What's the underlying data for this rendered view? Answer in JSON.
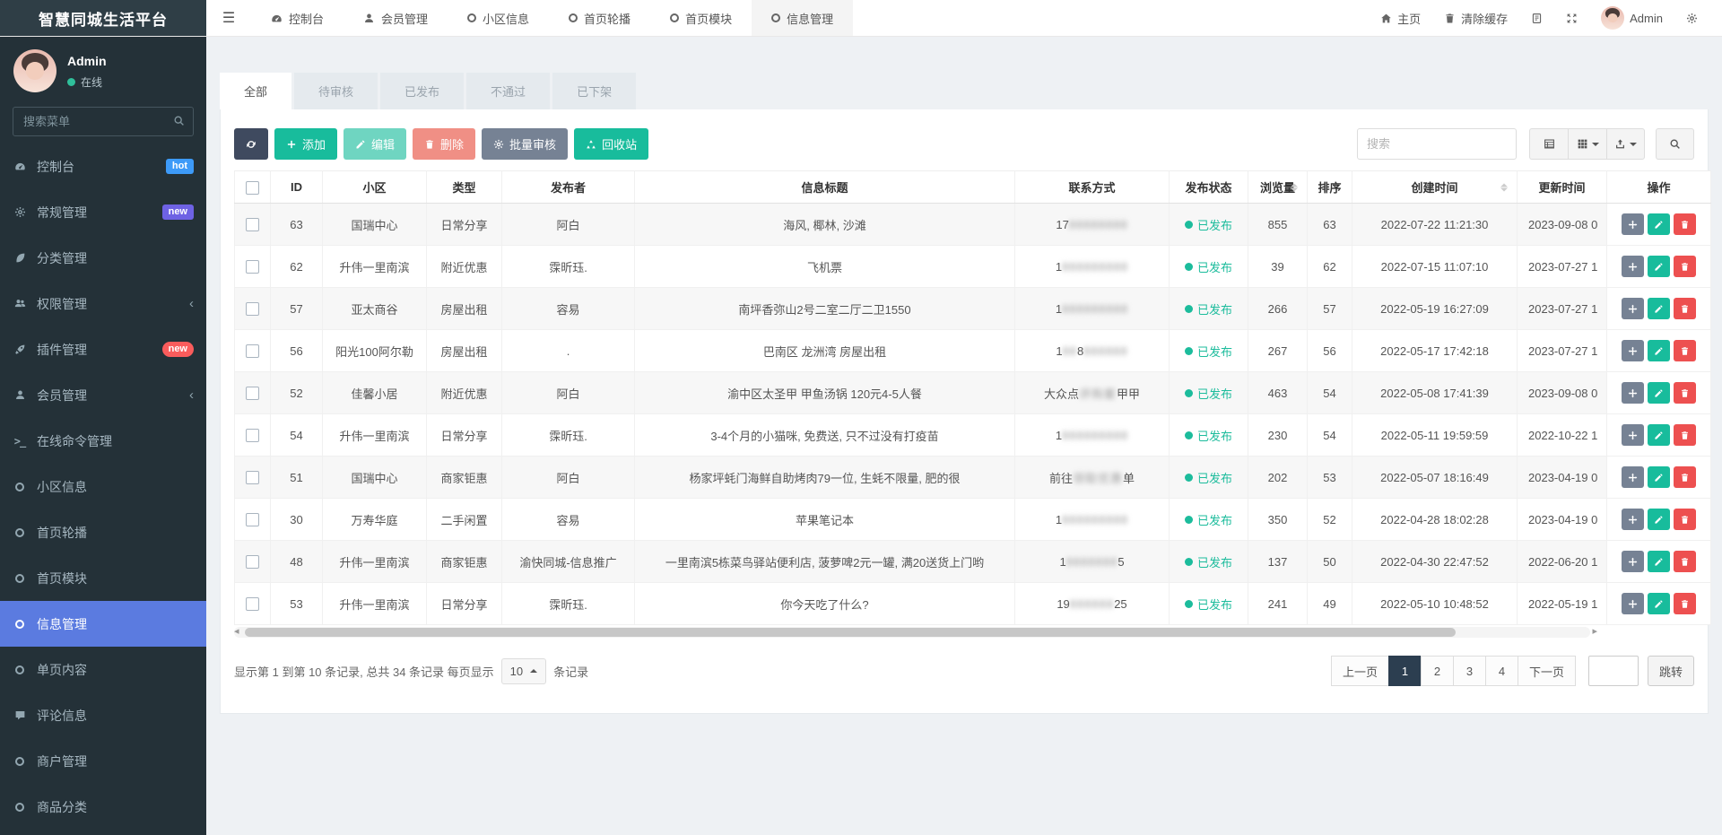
{
  "brand": "智慧同城生活平台",
  "topnav": {
    "tabs": [
      {
        "label": "控制台",
        "icon": "dashboard",
        "active": false
      },
      {
        "label": "会员管理",
        "icon": "user",
        "active": false
      },
      {
        "label": "小区信息",
        "icon": "circle",
        "active": false
      },
      {
        "label": "首页轮播",
        "icon": "circle",
        "active": false
      },
      {
        "label": "首页模块",
        "icon": "circle",
        "active": false
      },
      {
        "label": "信息管理",
        "icon": "circle",
        "active": true
      }
    ],
    "right": {
      "home": "主页",
      "clear_cache": "清除缓存",
      "username": "Admin"
    }
  },
  "sidebar": {
    "user": {
      "name": "Admin",
      "status": "在线"
    },
    "search_placeholder": "搜索菜单",
    "items": [
      {
        "label": "控制台",
        "icon": "dashboard",
        "badge": "hot",
        "badge_color": "#3d9af8",
        "badge_pill": false
      },
      {
        "label": "常规管理",
        "icon": "gear",
        "badge": "new",
        "badge_color": "#6e62e4",
        "badge_pill": false
      },
      {
        "label": "分类管理",
        "icon": "leaf"
      },
      {
        "label": "权限管理",
        "icon": "users",
        "chevron": true
      },
      {
        "label": "插件管理",
        "icon": "rocket",
        "badge": "new",
        "badge_color": "#fa5c5c",
        "badge_pill": true
      },
      {
        "label": "会员管理",
        "icon": "user",
        "chevron": true
      },
      {
        "label": "在线命令管理",
        "icon": "terminal"
      },
      {
        "label": "小区信息",
        "icon": "circle"
      },
      {
        "label": "首页轮播",
        "icon": "circle"
      },
      {
        "label": "首页模块",
        "icon": "circle"
      },
      {
        "label": "信息管理",
        "icon": "circle",
        "active": true
      },
      {
        "label": "单页内容",
        "icon": "circle"
      },
      {
        "label": "评论信息",
        "icon": "comment"
      },
      {
        "label": "商户管理",
        "icon": "circle"
      },
      {
        "label": "商品分类",
        "icon": "circle"
      }
    ]
  },
  "status_tabs": [
    {
      "label": "全部",
      "active": true
    },
    {
      "label": "待审核",
      "active": false
    },
    {
      "label": "已发布",
      "active": false
    },
    {
      "label": "不通过",
      "active": false
    },
    {
      "label": "已下架",
      "active": false
    }
  ],
  "toolbar": {
    "search_placeholder": "搜索",
    "buttons": [
      {
        "name": "refresh",
        "icon": "refresh",
        "label": "",
        "color": "#3f4a5f",
        "disabled": false
      },
      {
        "name": "add",
        "icon": "plus",
        "label": "添加",
        "color": "#18bc9c",
        "disabled": false
      },
      {
        "name": "edit",
        "icon": "pencil",
        "label": "编辑",
        "color": "#18bc9c",
        "disabled": true
      },
      {
        "name": "delete",
        "icon": "trash",
        "label": "删除",
        "color": "#e74c3c",
        "disabled": true
      },
      {
        "name": "batch-audit",
        "icon": "gear",
        "label": "批量审核",
        "color": "#768294",
        "disabled": false
      },
      {
        "name": "recycle-bin",
        "icon": "recycle",
        "label": "回收站",
        "color": "#18bc9c",
        "disabled": false
      }
    ],
    "view_buttons": [
      {
        "name": "view-list",
        "icon": "list",
        "caret": false
      },
      {
        "name": "view-grid",
        "icon": "grid",
        "caret": true
      },
      {
        "name": "export",
        "icon": "export",
        "caret": true
      }
    ]
  },
  "table": {
    "columns": [
      {
        "label": "",
        "checkbox": true
      },
      {
        "label": "ID"
      },
      {
        "label": "小区"
      },
      {
        "label": "类型"
      },
      {
        "label": "发布者"
      },
      {
        "label": "信息标题"
      },
      {
        "label": "联系方式"
      },
      {
        "label": "发布状态"
      },
      {
        "label": "浏览量",
        "sortable": true
      },
      {
        "label": "排序"
      },
      {
        "label": "创建时间",
        "sortable": true
      },
      {
        "label": "更新时间"
      },
      {
        "label": "操作",
        "ops": true
      }
    ],
    "ops_buttons": [
      {
        "name": "move",
        "icon": "move",
        "color": "#768294"
      },
      {
        "name": "edit-row",
        "icon": "pencil",
        "color": "#18bc9c"
      },
      {
        "name": "delete-row",
        "icon": "trash",
        "color": "#ed5050"
      }
    ],
    "status_published": "已发布",
    "rows": [
      {
        "id": "63",
        "community": "国瑞中心",
        "type": "日常分享",
        "publisher": "阿白",
        "title": "海风, 椰林, 沙滩",
        "contact": [
          {
            "t": "17",
            "blur": false
          },
          {
            "t": "88888888",
            "blur": true
          }
        ],
        "views": "855",
        "sort": "63",
        "created": "2022-07-22 11:21:30",
        "updated": "2023-09-08 0"
      },
      {
        "id": "62",
        "community": "升伟一里南滨",
        "type": "附近优惠",
        "publisher": "霂昕珏.",
        "title": "飞机票",
        "contact": [
          {
            "t": "1",
            "blur": false
          },
          {
            "t": "888888888",
            "blur": true
          }
        ],
        "views": "39",
        "sort": "62",
        "created": "2022-07-15 11:07:10",
        "updated": "2023-07-27 1"
      },
      {
        "id": "57",
        "community": "亚太商谷",
        "type": "房屋出租",
        "publisher": "容易",
        "title": "南坪香弥山2号二室二厅二卫1550",
        "contact": [
          {
            "t": "1",
            "blur": false
          },
          {
            "t": "888888888",
            "blur": true
          }
        ],
        "views": "266",
        "sort": "57",
        "created": "2022-05-19 16:27:09",
        "updated": "2023-07-27 1"
      },
      {
        "id": "56",
        "community": "阳光100阿尔勒",
        "type": "房屋出租",
        "publisher": ".",
        "title": "巴南区 龙洲湾 房屋出租",
        "contact": [
          {
            "t": "1",
            "blur": false
          },
          {
            "t": "88",
            "blur": true
          },
          {
            "t": "8",
            "blur": false
          },
          {
            "t": "888888",
            "blur": true
          }
        ],
        "views": "267",
        "sort": "56",
        "created": "2022-05-17 17:42:18",
        "updated": "2023-07-27 1"
      },
      {
        "id": "52",
        "community": "佳馨小居",
        "type": "附近优惠",
        "publisher": "阿白",
        "title": "渝中区太圣甲 甲鱼汤锅 120元4-5人餐",
        "contact": [
          {
            "t": "大众点",
            "blur": false
          },
          {
            "t": "评购套",
            "blur": true
          },
          {
            "t": "甲甲",
            "blur": false
          }
        ],
        "views": "463",
        "sort": "54",
        "created": "2022-05-08 17:41:39",
        "updated": "2023-09-08 0"
      },
      {
        "id": "54",
        "community": "升伟一里南滨",
        "type": "日常分享",
        "publisher": "霂昕珏.",
        "title": "3-4个月的小猫咪, 免费送, 只不过没有打疫苗",
        "contact": [
          {
            "t": "1",
            "blur": false
          },
          {
            "t": "888888888",
            "blur": true
          }
        ],
        "views": "230",
        "sort": "54",
        "created": "2022-05-11 19:59:59",
        "updated": "2022-10-22 1"
      },
      {
        "id": "51",
        "community": "国瑞中心",
        "type": "商家钜惠",
        "publisher": "阿白",
        "title": "杨家坪蚝门海鲜自助烤肉79一位, 生蚝不限量, 肥的很",
        "contact": [
          {
            "t": "前往",
            "blur": false
          },
          {
            "t": "领取优惠",
            "blur": true
          },
          {
            "t": "单",
            "blur": false
          }
        ],
        "views": "202",
        "sort": "53",
        "created": "2022-05-07 18:16:49",
        "updated": "2023-04-19 0"
      },
      {
        "id": "30",
        "community": "万寿华庭",
        "type": "二手闲置",
        "publisher": "容易",
        "title": "苹果笔记本",
        "contact": [
          {
            "t": "1",
            "blur": false
          },
          {
            "t": "888888888",
            "blur": true
          }
        ],
        "views": "350",
        "sort": "52",
        "created": "2022-04-28 18:02:28",
        "updated": "2023-04-19 0"
      },
      {
        "id": "48",
        "community": "升伟一里南滨",
        "type": "商家钜惠",
        "publisher": "渝快同城-信息推广",
        "title": "一里南滨5栋菜鸟驿站便利店, 菠萝啤2元一罐, 满20送货上门哟",
        "contact": [
          {
            "t": "1",
            "blur": false
          },
          {
            "t": "8888888",
            "blur": true
          },
          {
            "t": "5",
            "blur": false
          }
        ],
        "views": "137",
        "sort": "50",
        "created": "2022-04-30 22:47:52",
        "updated": "2022-06-20 1"
      },
      {
        "id": "53",
        "community": "升伟一里南滨",
        "type": "日常分享",
        "publisher": "霂昕珏.",
        "title": "你今天吃了什么?",
        "contact": [
          {
            "t": "19",
            "blur": false
          },
          {
            "t": "888888",
            "blur": true
          },
          {
            "t": "25",
            "blur": false
          }
        ],
        "views": "241",
        "sort": "49",
        "created": "2022-05-10 10:48:52",
        "updated": "2022-05-19 1"
      }
    ]
  },
  "footer": {
    "summary_prefix": "显示第 1 到第 10 条记录, 总共 34 条记录 每页显示",
    "page_size": "10",
    "summary_suffix": "条记录",
    "pagination": {
      "prev": "上一页",
      "pages": [
        "1",
        "2",
        "3",
        "4"
      ],
      "active": "1",
      "next": "下一页",
      "jump": "跳转"
    }
  },
  "colors": {
    "green": "#18bc9c",
    "red": "#ed5050",
    "sidebar_active": "#5b7be0",
    "pagination_active": "#2c3e50"
  }
}
